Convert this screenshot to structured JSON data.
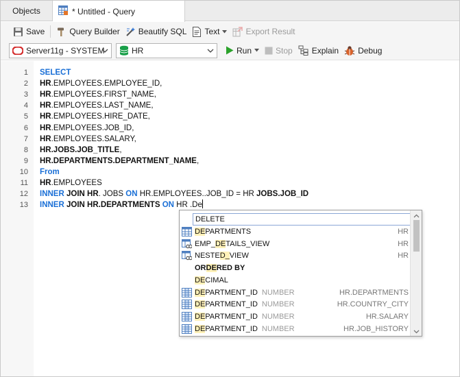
{
  "tabs": {
    "objects": "Objects",
    "query": "* Untitled - Query"
  },
  "toolbar": {
    "save": "Save",
    "query_builder": "Query Builder",
    "beautify_sql": "Beautify SQL",
    "text": "Text",
    "export_result": "Export Result",
    "connection": "Server11g - SYSTEM",
    "database": "HR",
    "run": "Run",
    "stop": "Stop",
    "explain": "Explain",
    "debug": "Debug"
  },
  "icons": {
    "tab_query": "query-grid-icon",
    "save": "floppy-disk-icon",
    "query_builder": "hammer-icon",
    "beautify": "magic-wand-icon",
    "text": "document-text-icon",
    "export": "export-icon",
    "connection": "oracle-icon",
    "database": "database-icon",
    "run": "play-icon",
    "stop": "stop-square-icon",
    "explain": "explain-tree-icon",
    "debug": "bug-icon"
  },
  "colors": {
    "keyword": "#1a6fd6",
    "run_green": "#2aa22a",
    "db_green": "#19a049",
    "oracle_red": "#d32a2a",
    "highlight": "#fff1b8"
  },
  "editor": {
    "lines": [
      {
        "n": "1",
        "segments": [
          {
            "t": "SELECT",
            "c": "kw"
          }
        ]
      },
      {
        "n": "2",
        "segments": [
          {
            "t": "HR",
            "c": "bold"
          },
          {
            "t": ".EMPLOYEES.EMPLOYEE_ID,",
            "c": ""
          }
        ]
      },
      {
        "n": "3",
        "segments": [
          {
            "t": "HR",
            "c": "bold"
          },
          {
            "t": ".EMPLOYEES.FIRST_NAME,",
            "c": ""
          }
        ]
      },
      {
        "n": "4",
        "segments": [
          {
            "t": "HR",
            "c": "bold"
          },
          {
            "t": ".EMPLOYEES.LAST_NAME,",
            "c": ""
          }
        ]
      },
      {
        "n": "5",
        "segments": [
          {
            "t": "HR",
            "c": "bold"
          },
          {
            "t": ".EMPLOYEES.HIRE_DATE,",
            "c": ""
          }
        ]
      },
      {
        "n": "6",
        "segments": [
          {
            "t": "HR",
            "c": "bold"
          },
          {
            "t": ".EMPLOYEES.JOB_ID,",
            "c": ""
          }
        ]
      },
      {
        "n": "7",
        "segments": [
          {
            "t": "HR",
            "c": "bold"
          },
          {
            "t": ".EMPLOYEES.SALARY,",
            "c": ""
          }
        ]
      },
      {
        "n": "8",
        "segments": [
          {
            "t": "HR.JOBS.JOB_TITLE",
            "c": "bold"
          },
          {
            "t": ",",
            "c": ""
          }
        ]
      },
      {
        "n": "9",
        "segments": [
          {
            "t": "HR.DEPARTMENTS.DEPARTMENT_NAME",
            "c": "bold"
          },
          {
            "t": ",",
            "c": ""
          }
        ]
      },
      {
        "n": "10",
        "segments": [
          {
            "t": "From",
            "c": "kw"
          }
        ]
      },
      {
        "n": "11",
        "segments": [
          {
            "t": "HR",
            "c": "bold"
          },
          {
            "t": ".EMPLOYEES",
            "c": ""
          }
        ]
      },
      {
        "n": "12",
        "segments": [
          {
            "t": "INNER",
            "c": "kw"
          },
          {
            "t": " ",
            "c": ""
          },
          {
            "t": "JOIN HR",
            "c": "bold"
          },
          {
            "t": ". JOBS ",
            "c": ""
          },
          {
            "t": "ON",
            "c": "kw"
          },
          {
            "t": " HR.EMPLOYEES..JOB_ID = HR ",
            "c": ""
          },
          {
            "t": "JOBS.JOB_ID",
            "c": "bold"
          }
        ]
      },
      {
        "n": "13",
        "segments": [
          {
            "t": "INNER",
            "c": "kw"
          },
          {
            "t": " ",
            "c": ""
          },
          {
            "t": "JOIN HR.DEPARTMENTS",
            "c": "bold"
          },
          {
            "t": " ",
            "c": ""
          },
          {
            "t": "ON",
            "c": "kw"
          },
          {
            "t": " HR .De",
            "c": ""
          }
        ]
      }
    ]
  },
  "autocomplete": {
    "search_value": "DELETE",
    "items": [
      {
        "pre": "",
        "hl": "DE",
        "post": "PARTMENTS",
        "type": "",
        "owner": "HR",
        "icon": "table-icon",
        "bold": false
      },
      {
        "pre": "EMP_",
        "hl": "DE",
        "post": "TAILS_VIEW",
        "type": "",
        "owner": "HR",
        "icon": "view-icon",
        "bold": false
      },
      {
        "pre": "NESTE",
        "hl": "D_",
        "post": "VIEW",
        "type": "",
        "owner": "HR",
        "icon": "view-icon",
        "bold": false
      },
      {
        "pre": "OR",
        "hl": "DE",
        "post": "RED BY",
        "type": "",
        "owner": "",
        "icon": "",
        "bold": true
      },
      {
        "pre": "",
        "hl": "DE",
        "post": "CIMAL",
        "type": "",
        "owner": "",
        "icon": "",
        "bold": false
      },
      {
        "pre": "",
        "hl": "DE",
        "post": "PARTMENT_ID",
        "type": "NUMBER",
        "owner": "HR.DEPARTMENTS",
        "icon": "column-icon",
        "bold": false
      },
      {
        "pre": "",
        "hl": "DE",
        "post": "PARTMENT_ID",
        "type": "NUMBER",
        "owner": "HR.COUNTRY_CITY",
        "icon": "column-icon",
        "bold": false
      },
      {
        "pre": "",
        "hl": "DE",
        "post": "PARTMENT_ID",
        "type": "NUMBER",
        "owner": "HR.SALARY",
        "icon": "column-icon",
        "bold": false
      },
      {
        "pre": "",
        "hl": "DE",
        "post": "PARTMENT_ID",
        "type": "NUMBER",
        "owner": "HR.JOB_HISTORY",
        "icon": "column-icon",
        "bold": false
      }
    ]
  }
}
